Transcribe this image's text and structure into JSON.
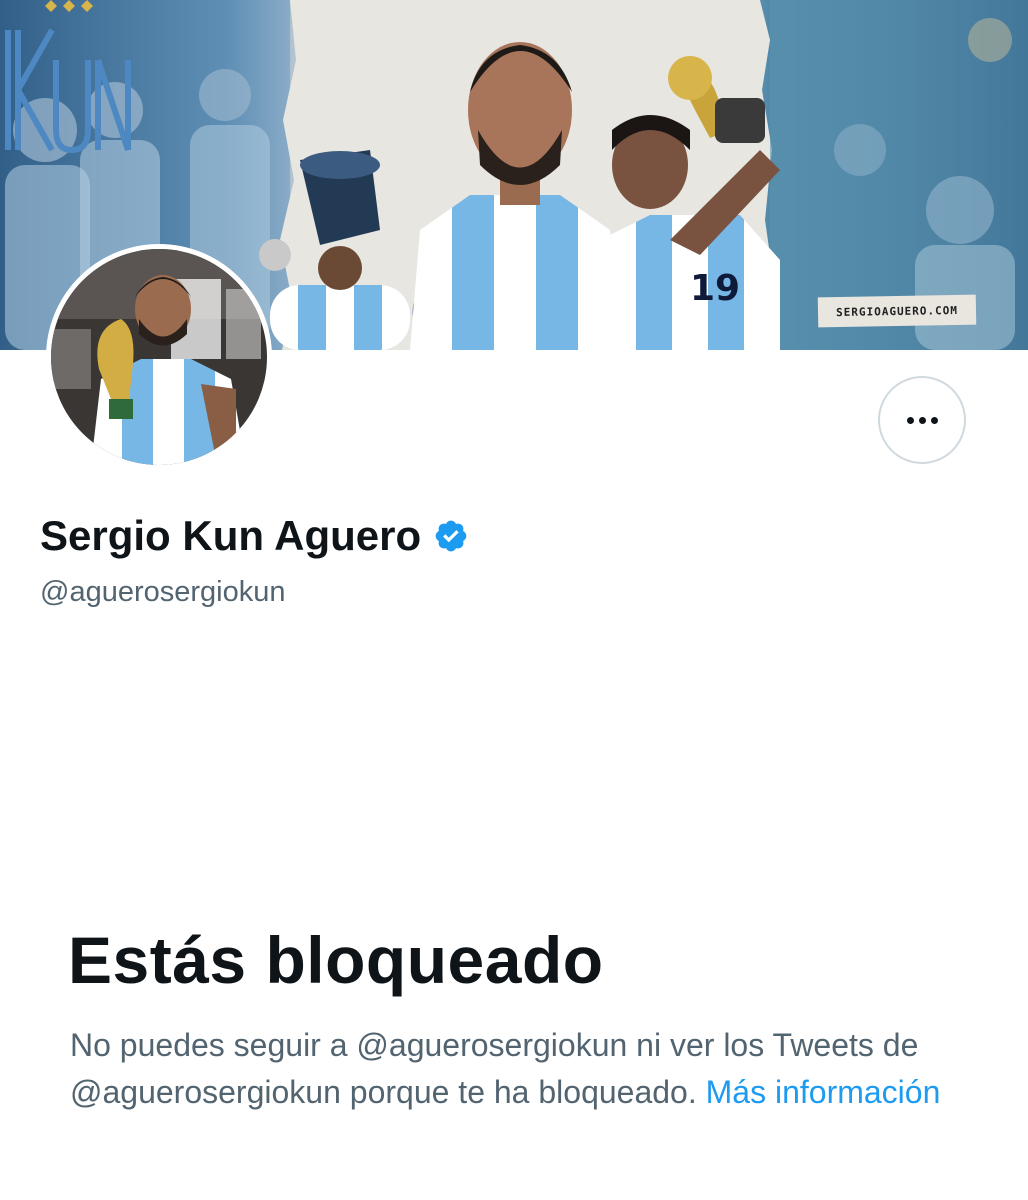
{
  "banner": {
    "watermark_text": "SERGIOAGUERO.COM",
    "logo_text": "KUN"
  },
  "profile": {
    "display_name": "Sergio Kun Aguero",
    "handle": "@aguerosergiokun",
    "verified": true
  },
  "blocked": {
    "title": "Estás bloqueado",
    "message": "No puedes seguir a @aguerosergiokun ni ver los Tweets de @aguerosergiokun porque te ha bloqueado.",
    "link_label": "Más información"
  },
  "colors": {
    "text_primary": "#0f1419",
    "text_secondary": "#536471",
    "link": "#1d9bf0",
    "verified_badge": "#1d9bf0",
    "button_border": "#cfd9de"
  },
  "icons": {
    "more_button": "more-horizontal-icon",
    "verified": "verified-badge-icon"
  }
}
